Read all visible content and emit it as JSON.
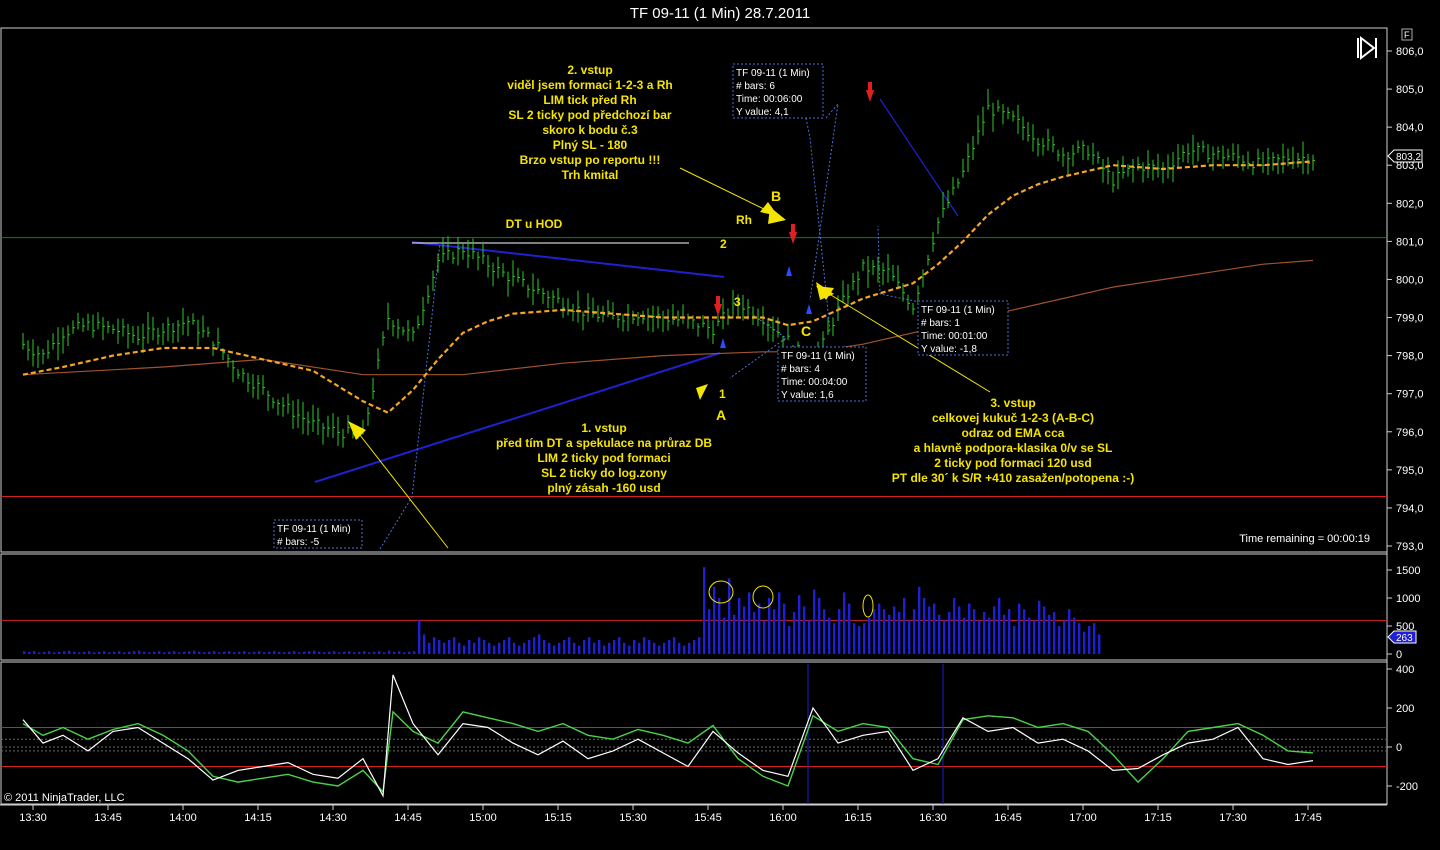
{
  "window": {
    "title": "TF 09-11 (1 Min)  28.7.2011",
    "corner_button": "F"
  },
  "status": {
    "time_remaining": "Time remaining = 00:00:19",
    "copyright": "© 2011 NinjaTrader, LLC"
  },
  "colors": {
    "bar": "#2ecc2e",
    "ema": "#f5a623",
    "sma": "#a0522d",
    "volume": "#1f1fd6",
    "resistance": "#1a7a1a",
    "support": "#d62020",
    "trend": "#2020d0",
    "arrow_yellow": "#f5e400",
    "cci": "#4ad24a",
    "cci2": "#ffffff"
  },
  "chart_data": [
    {
      "type": "line",
      "title": "TF 09-11 (1 Min)  28.7.2011",
      "y_ticks": [
        "806,0",
        "805,0",
        "804,0",
        "803,0",
        "802,0",
        "801,0",
        "800,0",
        "799,0",
        "798,0",
        "797,0",
        "796,0",
        "795,0",
        "794,0",
        "793,0"
      ],
      "ylim": [
        793,
        806.2
      ],
      "last_price": "803,2",
      "x_ticks": [
        "13:30",
        "13:45",
        "14:00",
        "14:15",
        "14:30",
        "14:45",
        "15:00",
        "15:15",
        "15:30",
        "15:45",
        "16:00",
        "16:15",
        "16:30",
        "16:45",
        "17:00",
        "17:15",
        "17:30",
        "17:45"
      ],
      "xlim_minutes": [
        810,
        1090
      ],
      "resistance_level": 801.1,
      "support_level": 794.3,
      "series": [
        {
          "key": "price",
          "x": [
            812,
            816,
            820,
            825,
            830,
            835,
            840,
            845,
            850,
            855,
            860,
            865,
            870,
            875,
            880,
            885,
            890,
            895,
            900,
            905,
            910,
            915,
            920,
            925,
            930,
            935,
            940,
            945,
            950,
            955,
            960,
            965,
            970,
            975,
            980,
            985,
            990,
            995,
            1000,
            1005,
            1010,
            1015,
            1020,
            1025,
            1030,
            1035,
            1040,
            1045,
            1050,
            1055,
            1060,
            1065,
            1070
          ],
          "y": [
            798.3,
            798.0,
            798.6,
            798.8,
            798.7,
            798.5,
            798.7,
            798.9,
            798.4,
            797.6,
            797.1,
            796.6,
            796.2,
            796.0,
            795.9,
            799.0,
            798.5,
            800.5,
            800.8,
            800.4,
            800.0,
            799.7,
            799.4,
            799.1,
            799.0,
            799.1,
            799.0,
            798.9,
            798.7,
            799.4,
            799.0,
            798.4,
            797.7,
            799.2,
            800.3,
            800.2,
            799.3,
            801.5,
            802.8,
            804.5,
            804.2,
            803.7,
            803.3,
            803.4,
            802.6,
            803.0,
            802.9,
            803.4,
            803.3,
            803.2,
            803.0,
            803.2,
            803.2
          ]
        },
        {
          "key": "ema",
          "name": "",
          "x": [
            812,
            820,
            830,
            840,
            850,
            860,
            870,
            880,
            885,
            890,
            895,
            900,
            905,
            910,
            920,
            930,
            940,
            950,
            960,
            965,
            970,
            975,
            980,
            985,
            990,
            995,
            1000,
            1005,
            1010,
            1015,
            1020,
            1030,
            1040,
            1050,
            1060,
            1070
          ],
          "y": [
            797.5,
            797.7,
            798.0,
            798.2,
            798.2,
            797.9,
            797.6,
            796.8,
            796.5,
            797.1,
            797.9,
            798.6,
            798.9,
            799.1,
            799.2,
            799.1,
            799.0,
            799.0,
            799.0,
            798.8,
            798.9,
            799.2,
            799.5,
            799.7,
            799.9,
            800.4,
            801.0,
            801.7,
            802.2,
            802.5,
            802.7,
            803.0,
            802.9,
            803.0,
            803.0,
            803.1
          ]
        },
        {
          "key": "sma",
          "name": "",
          "x": [
            812,
            840,
            860,
            880,
            900,
            920,
            940,
            960,
            970,
            980,
            990,
            1000,
            1010,
            1020,
            1030,
            1040,
            1050,
            1060,
            1070
          ],
          "y": [
            797.5,
            797.7,
            797.9,
            797.5,
            797.5,
            797.8,
            798.0,
            798.1,
            798.1,
            798.3,
            798.6,
            798.9,
            799.2,
            799.5,
            799.8,
            800.0,
            800.2,
            800.4,
            800.5
          ]
        }
      ],
      "annotations": [
        {
          "key": "a1",
          "lines": [
            "2. vstup",
            "viděl jsem formaci 1-2-3 a Rh",
            "LIM tick před Rh",
            "SL 2 ticky pod předchozí bar",
            "skoro k bodu č.3",
            "Plný SL - 180",
            "Brzo vstup po reportu !!!",
            "Trh kmital"
          ]
        },
        {
          "key": "a2",
          "lines": [
            "1. vstup",
            "před tím DT a spekulace na průraz DB",
            "LIM 2 ticky pod formaci",
            "SL 2 ticky do log.zony",
            "plný zásah -160 usd"
          ]
        },
        {
          "key": "a3",
          "lines": [
            "3. vstup",
            "celkovej kukuč 1-2-3 (A-B-C)",
            "odraz od EMA cca",
            "a hlavně podpora-klasika 0/v se SL",
            "2 ticky pod formaci 120 usd",
            "PT dle 30´ k S/R +410 zasažen/potopena :-)"
          ]
        }
      ],
      "labels": {
        "dt": "DT u HOD",
        "rh": "Rh",
        "B": "B",
        "A": "A",
        "C": "C",
        "n1": "1",
        "n2": "2",
        "n3": "3"
      },
      "info_boxes": [
        {
          "key": "b1",
          "lines": [
            "TF 09-11 (1 Min)",
            "# bars:   6",
            "Time:     00:06:00",
            "Y value: 4,1"
          ]
        },
        {
          "key": "b2",
          "lines": [
            "TF 09-11 (1 Min)",
            "# bars:   4",
            "Time:     00:04:00",
            "Y value: 1,6"
          ]
        },
        {
          "key": "b3",
          "lines": [
            "TF 09-11 (1 Min)",
            "# bars:   1",
            "Time:     00:01:00",
            "Y value: -1,8"
          ]
        },
        {
          "key": "b4",
          "lines": [
            "TF 09-11 (1 Min)",
            "# bars:   -5"
          ]
        }
      ]
    },
    {
      "type": "bar",
      "y_ticks": [
        "1500",
        "1000",
        "500",
        "0"
      ],
      "ylim": [
        0,
        1600
      ],
      "last_value": "263",
      "reference_level": 600,
      "x_start": 812,
      "x_step": 1,
      "values": [
        50,
        40,
        50,
        30,
        40,
        50,
        30,
        40,
        50,
        60,
        40,
        30,
        40,
        50,
        30,
        40,
        50,
        30,
        40,
        50,
        30,
        40,
        50,
        60,
        40,
        30,
        40,
        50,
        30,
        40,
        50,
        30,
        40,
        50,
        60,
        40,
        30,
        40,
        50,
        30,
        40,
        50,
        30,
        40,
        50,
        30,
        40,
        50,
        30,
        40,
        50,
        40,
        30,
        40,
        50,
        30,
        40,
        50,
        60,
        40,
        30,
        40,
        50,
        30,
        40,
        50,
        30,
        40,
        50,
        30,
        40,
        50,
        30,
        60,
        40,
        50,
        30,
        40,
        50,
        600,
        350,
        200,
        300,
        250,
        200,
        250,
        300,
        200,
        150,
        250,
        200,
        300,
        250,
        200,
        150,
        200,
        250,
        300,
        200,
        150,
        200,
        250,
        300,
        350,
        250,
        200,
        150,
        200,
        250,
        300,
        200,
        150,
        250,
        300,
        200,
        250,
        150,
        200,
        250,
        300,
        200,
        150,
        250,
        200,
        300,
        250,
        200,
        150,
        200,
        250,
        300,
        200,
        150,
        200,
        250,
        300,
        1550,
        800,
        1200,
        1000,
        650,
        1350,
        700,
        1000,
        850,
        1100,
        750,
        900,
        600,
        1000,
        800,
        1100,
        900,
        500,
        750,
        1050,
        850,
        600,
        1150,
        1000,
        800,
        650,
        550,
        800,
        1100,
        900,
        550,
        500,
        550,
        650,
        800,
        900,
        800,
        700,
        850,
        750,
        1000,
        600,
        800,
        1200,
        1000,
        850,
        900,
        700,
        600,
        750,
        1000,
        850,
        650,
        900,
        800,
        600,
        750,
        650,
        850,
        1000,
        700,
        800,
        500,
        900,
        800,
        650,
        600,
        950,
        850,
        700,
        750,
        500,
        600,
        800,
        650,
        550,
        400,
        500,
        550,
        350,
        600,
        400,
        300,
        450,
        350,
        400,
        500,
        300,
        350,
        400,
        250,
        300,
        450,
        350,
        300,
        200,
        250,
        400,
        300,
        350,
        250,
        1000,
        300,
        400,
        350,
        250,
        300,
        450,
        350,
        200,
        300,
        400,
        250,
        350,
        1300,
        400,
        300,
        350,
        450,
        500,
        350,
        400,
        300,
        350,
        400,
        250,
        300,
        350,
        400,
        1550,
        500,
        300,
        400,
        350,
        450,
        400,
        300,
        350,
        500,
        400,
        300,
        700,
        400,
        350,
        300,
        250,
        350,
        400,
        300,
        263
      ]
    },
    {
      "type": "line",
      "y_ticks": [
        "400",
        "200",
        "0",
        "-200"
      ],
      "ylim": [
        -290,
        420
      ],
      "levels": [
        100,
        -100
      ],
      "series": [
        {
          "key": "cci",
          "name": "",
          "x": [
            812,
            816,
            820,
            825,
            830,
            835,
            840,
            845,
            850,
            855,
            860,
            865,
            870,
            875,
            880,
            884,
            886,
            890,
            895,
            900,
            905,
            910,
            915,
            920,
            925,
            930,
            935,
            940,
            945,
            950,
            955,
            960,
            965,
            970,
            975,
            980,
            985,
            990,
            995,
            1000,
            1005,
            1010,
            1015,
            1020,
            1025,
            1030,
            1035,
            1040,
            1045,
            1050,
            1055,
            1060,
            1065,
            1070
          ],
          "y": [
            120,
            60,
            100,
            40,
            90,
            120,
            60,
            -20,
            -150,
            -180,
            -160,
            -140,
            -180,
            -200,
            -120,
            -230,
            180,
            80,
            20,
            180,
            150,
            120,
            80,
            120,
            60,
            40,
            90,
            60,
            20,
            110,
            -60,
            -150,
            -200,
            160,
            80,
            120,
            100,
            -60,
            -90,
            140,
            160,
            150,
            100,
            120,
            80,
            -40,
            -180,
            -60,
            80,
            100,
            120,
            60,
            -20,
            -30
          ]
        },
        {
          "key": "cci2",
          "name": "",
          "x": [
            812,
            816,
            820,
            825,
            830,
            835,
            840,
            845,
            850,
            855,
            860,
            865,
            870,
            875,
            880,
            884,
            886,
            890,
            895,
            900,
            905,
            910,
            915,
            920,
            925,
            930,
            935,
            940,
            945,
            950,
            955,
            960,
            965,
            970,
            975,
            980,
            985,
            990,
            995,
            1000,
            1005,
            1010,
            1015,
            1020,
            1025,
            1030,
            1035,
            1040,
            1045,
            1050,
            1055,
            1060,
            1065,
            1070
          ],
          "y": [
            140,
            20,
            60,
            -20,
            80,
            100,
            20,
            -60,
            -170,
            -120,
            -100,
            -80,
            -140,
            -160,
            -60,
            -250,
            370,
            120,
            -40,
            120,
            100,
            20,
            -40,
            30,
            -60,
            -20,
            40,
            -30,
            -100,
            80,
            -30,
            -120,
            -150,
            200,
            20,
            60,
            80,
            -120,
            -60,
            150,
            80,
            100,
            20,
            40,
            -20,
            -120,
            -110,
            -40,
            20,
            40,
            100,
            -60,
            -90,
            -70
          ]
        }
      ]
    }
  ]
}
